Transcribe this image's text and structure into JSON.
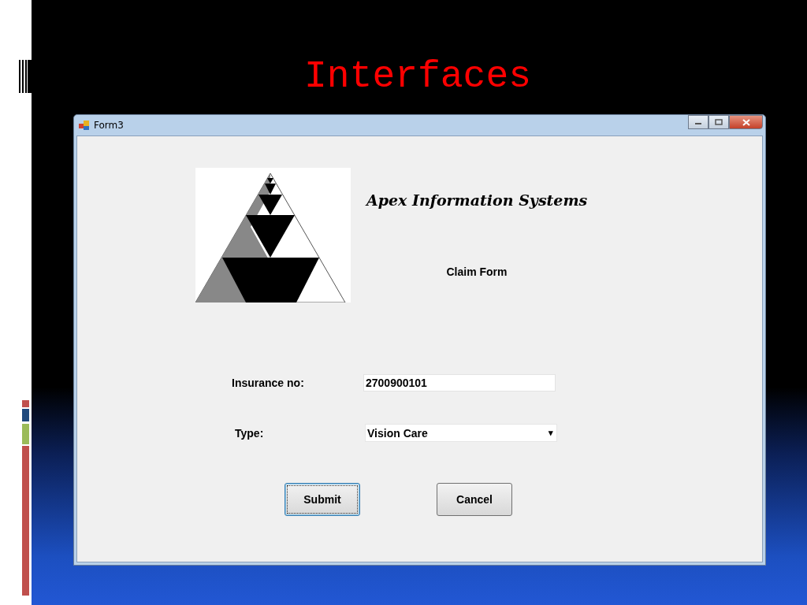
{
  "slide": {
    "title": "Interfaces"
  },
  "window": {
    "title": "Form3"
  },
  "form": {
    "company": "Apex Information Systems",
    "heading": "Claim Form",
    "fields": [
      {
        "kind": "text",
        "label": "Insurance no:",
        "value": "2700900101"
      },
      {
        "kind": "combo",
        "label": "Type:",
        "value": "Vision Care",
        "arrow": "▾"
      }
    ],
    "buttons": [
      {
        "label": "Submit",
        "default": true
      },
      {
        "label": "Cancel",
        "default": false
      }
    ]
  }
}
